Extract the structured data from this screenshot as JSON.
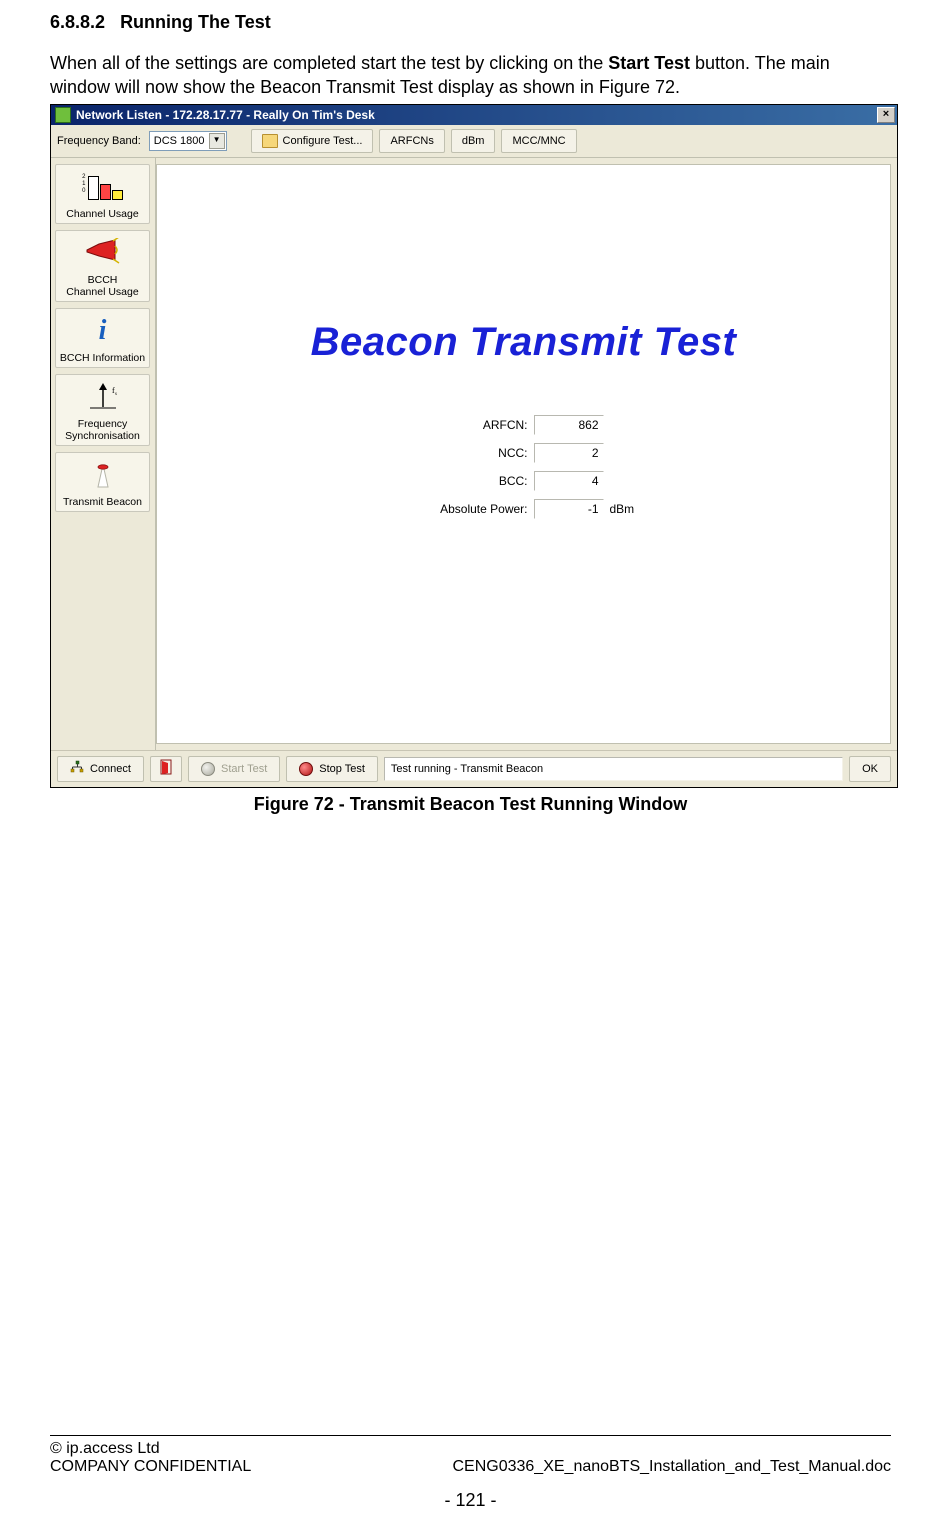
{
  "section": {
    "number": "6.8.8.2",
    "title": "Running The Test"
  },
  "body": {
    "para1_a": "When all of the settings are completed start the test by clicking on the ",
    "para1_bold": "Start Test",
    "para1_b": " button. The main window will now show the Beacon Transmit Test display as shown in Figure 72."
  },
  "window": {
    "titlebar": "Network Listen - 172.28.17.77 - Really On Tim's Desk",
    "toolbar": {
      "freq_band_label": "Frequency Band:",
      "freq_band_value": "DCS 1800",
      "configure_test": "Configure Test...",
      "arfcns": "ARFCNs",
      "dbm": "dBm",
      "mccmnc": "MCC/MNC"
    },
    "sidebar": {
      "channel_usage": "Channel Usage",
      "bcch_channel_usage": "BCCH\nChannel Usage",
      "bcch_information": "BCCH Information",
      "freq_sync": "Frequency\nSynchronisation",
      "transmit_beacon": "Transmit Beacon"
    },
    "main": {
      "title": "Beacon Transmit Test",
      "params": {
        "arfcn_label": "ARFCN:",
        "arfcn_value": "862",
        "ncc_label": "NCC:",
        "ncc_value": "2",
        "bcc_label": "BCC:",
        "bcc_value": "4",
        "abs_power_label": "Absolute Power:",
        "abs_power_value": "-1",
        "abs_power_unit": "dBm"
      }
    },
    "status": {
      "connect": "Connect",
      "start_test": "Start Test",
      "stop_test": "Stop Test",
      "status_text": "Test running - Transmit Beacon",
      "ok": "OK"
    }
  },
  "figure_caption": "Figure 72 - Transmit  Beacon Test Running Window",
  "footer": {
    "copyright": "© ip.access Ltd",
    "confidential": "COMPANY CONFIDENTIAL",
    "docname": "CENG0336_XE_nanoBTS_Installation_and_Test_Manual.doc",
    "page": "- 121 -"
  }
}
